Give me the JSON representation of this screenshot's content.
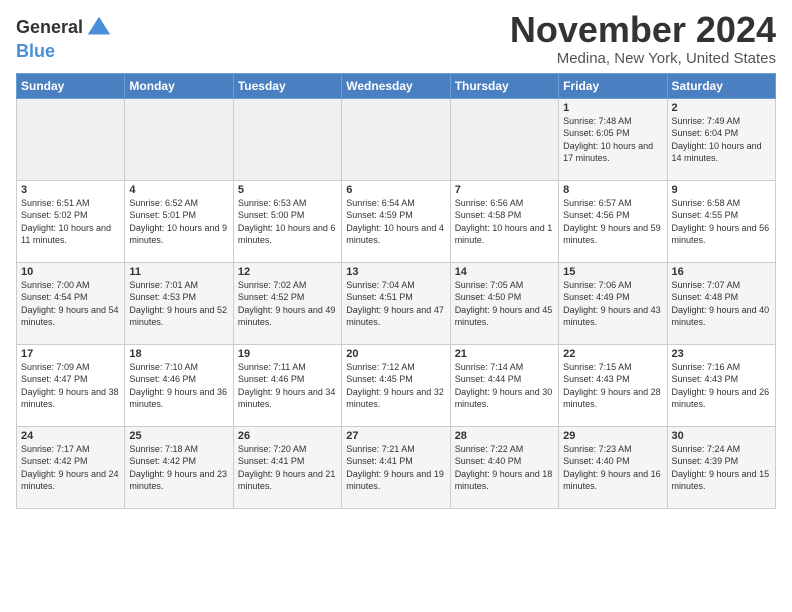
{
  "logo": {
    "line1": "General",
    "line2": "Blue"
  },
  "title": "November 2024",
  "location": "Medina, New York, United States",
  "weekdays": [
    "Sunday",
    "Monday",
    "Tuesday",
    "Wednesday",
    "Thursday",
    "Friday",
    "Saturday"
  ],
  "weeks": [
    [
      {
        "day": "",
        "info": ""
      },
      {
        "day": "",
        "info": ""
      },
      {
        "day": "",
        "info": ""
      },
      {
        "day": "",
        "info": ""
      },
      {
        "day": "",
        "info": ""
      },
      {
        "day": "1",
        "info": "Sunrise: 7:48 AM\nSunset: 6:05 PM\nDaylight: 10 hours and 17 minutes."
      },
      {
        "day": "2",
        "info": "Sunrise: 7:49 AM\nSunset: 6:04 PM\nDaylight: 10 hours and 14 minutes."
      }
    ],
    [
      {
        "day": "3",
        "info": "Sunrise: 6:51 AM\nSunset: 5:02 PM\nDaylight: 10 hours and 11 minutes."
      },
      {
        "day": "4",
        "info": "Sunrise: 6:52 AM\nSunset: 5:01 PM\nDaylight: 10 hours and 9 minutes."
      },
      {
        "day": "5",
        "info": "Sunrise: 6:53 AM\nSunset: 5:00 PM\nDaylight: 10 hours and 6 minutes."
      },
      {
        "day": "6",
        "info": "Sunrise: 6:54 AM\nSunset: 4:59 PM\nDaylight: 10 hours and 4 minutes."
      },
      {
        "day": "7",
        "info": "Sunrise: 6:56 AM\nSunset: 4:58 PM\nDaylight: 10 hours and 1 minute."
      },
      {
        "day": "8",
        "info": "Sunrise: 6:57 AM\nSunset: 4:56 PM\nDaylight: 9 hours and 59 minutes."
      },
      {
        "day": "9",
        "info": "Sunrise: 6:58 AM\nSunset: 4:55 PM\nDaylight: 9 hours and 56 minutes."
      }
    ],
    [
      {
        "day": "10",
        "info": "Sunrise: 7:00 AM\nSunset: 4:54 PM\nDaylight: 9 hours and 54 minutes."
      },
      {
        "day": "11",
        "info": "Sunrise: 7:01 AM\nSunset: 4:53 PM\nDaylight: 9 hours and 52 minutes."
      },
      {
        "day": "12",
        "info": "Sunrise: 7:02 AM\nSunset: 4:52 PM\nDaylight: 9 hours and 49 minutes."
      },
      {
        "day": "13",
        "info": "Sunrise: 7:04 AM\nSunset: 4:51 PM\nDaylight: 9 hours and 47 minutes."
      },
      {
        "day": "14",
        "info": "Sunrise: 7:05 AM\nSunset: 4:50 PM\nDaylight: 9 hours and 45 minutes."
      },
      {
        "day": "15",
        "info": "Sunrise: 7:06 AM\nSunset: 4:49 PM\nDaylight: 9 hours and 43 minutes."
      },
      {
        "day": "16",
        "info": "Sunrise: 7:07 AM\nSunset: 4:48 PM\nDaylight: 9 hours and 40 minutes."
      }
    ],
    [
      {
        "day": "17",
        "info": "Sunrise: 7:09 AM\nSunset: 4:47 PM\nDaylight: 9 hours and 38 minutes."
      },
      {
        "day": "18",
        "info": "Sunrise: 7:10 AM\nSunset: 4:46 PM\nDaylight: 9 hours and 36 minutes."
      },
      {
        "day": "19",
        "info": "Sunrise: 7:11 AM\nSunset: 4:46 PM\nDaylight: 9 hours and 34 minutes."
      },
      {
        "day": "20",
        "info": "Sunrise: 7:12 AM\nSunset: 4:45 PM\nDaylight: 9 hours and 32 minutes."
      },
      {
        "day": "21",
        "info": "Sunrise: 7:14 AM\nSunset: 4:44 PM\nDaylight: 9 hours and 30 minutes."
      },
      {
        "day": "22",
        "info": "Sunrise: 7:15 AM\nSunset: 4:43 PM\nDaylight: 9 hours and 28 minutes."
      },
      {
        "day": "23",
        "info": "Sunrise: 7:16 AM\nSunset: 4:43 PM\nDaylight: 9 hours and 26 minutes."
      }
    ],
    [
      {
        "day": "24",
        "info": "Sunrise: 7:17 AM\nSunset: 4:42 PM\nDaylight: 9 hours and 24 minutes."
      },
      {
        "day": "25",
        "info": "Sunrise: 7:18 AM\nSunset: 4:42 PM\nDaylight: 9 hours and 23 minutes."
      },
      {
        "day": "26",
        "info": "Sunrise: 7:20 AM\nSunset: 4:41 PM\nDaylight: 9 hours and 21 minutes."
      },
      {
        "day": "27",
        "info": "Sunrise: 7:21 AM\nSunset: 4:41 PM\nDaylight: 9 hours and 19 minutes."
      },
      {
        "day": "28",
        "info": "Sunrise: 7:22 AM\nSunset: 4:40 PM\nDaylight: 9 hours and 18 minutes."
      },
      {
        "day": "29",
        "info": "Sunrise: 7:23 AM\nSunset: 4:40 PM\nDaylight: 9 hours and 16 minutes."
      },
      {
        "day": "30",
        "info": "Sunrise: 7:24 AM\nSunset: 4:39 PM\nDaylight: 9 hours and 15 minutes."
      }
    ]
  ]
}
